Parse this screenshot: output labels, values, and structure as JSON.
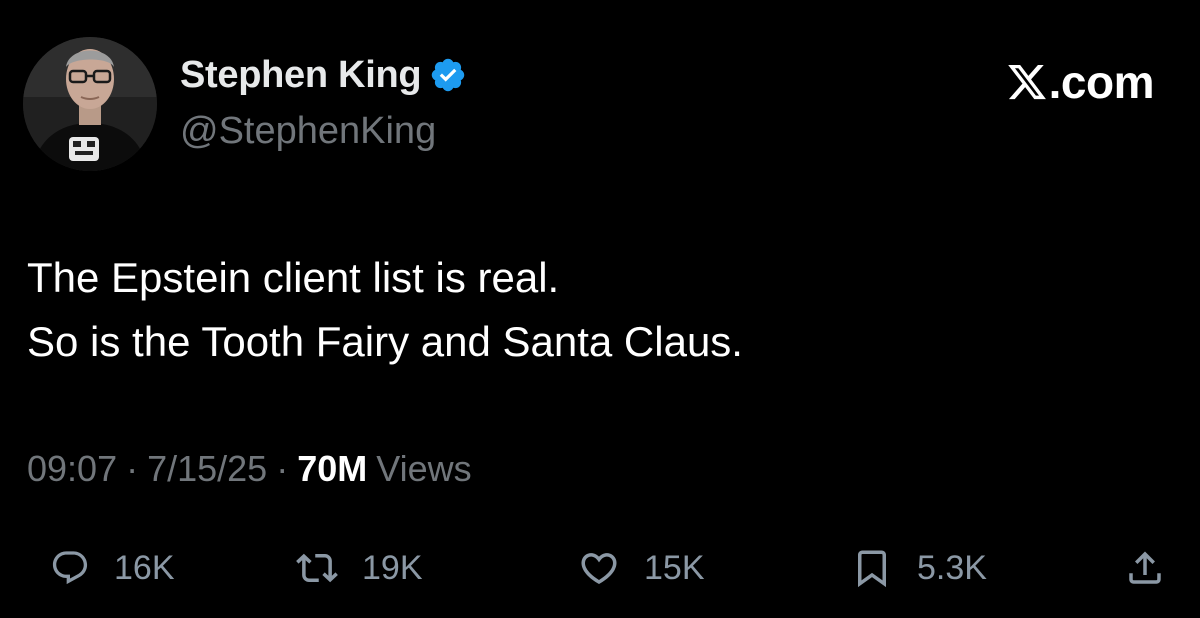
{
  "author": {
    "display_name": "Stephen King",
    "handle": "@StephenKing",
    "verified": true
  },
  "brand": {
    "text": ".com"
  },
  "tweet": {
    "lines": [
      "The Epstein client list is real.",
      "So is the Tooth Fairy and Santa Claus."
    ]
  },
  "meta": {
    "time": "09:07",
    "separator": "·",
    "date": "7/15/25",
    "views_count": "70M",
    "views_label": "Views"
  },
  "actions": {
    "replies": "16K",
    "reposts": "19K",
    "likes": "15K",
    "bookmarks": "5.3K"
  },
  "colors": {
    "background": "#000000",
    "primary_text": "#e7e9ea",
    "secondary_text": "#71767b",
    "verified_blue": "#1d9bf0"
  },
  "icons": [
    "verified-badge",
    "x-logo",
    "reply-icon",
    "repost-icon",
    "like-icon",
    "bookmark-icon",
    "share-icon"
  ]
}
